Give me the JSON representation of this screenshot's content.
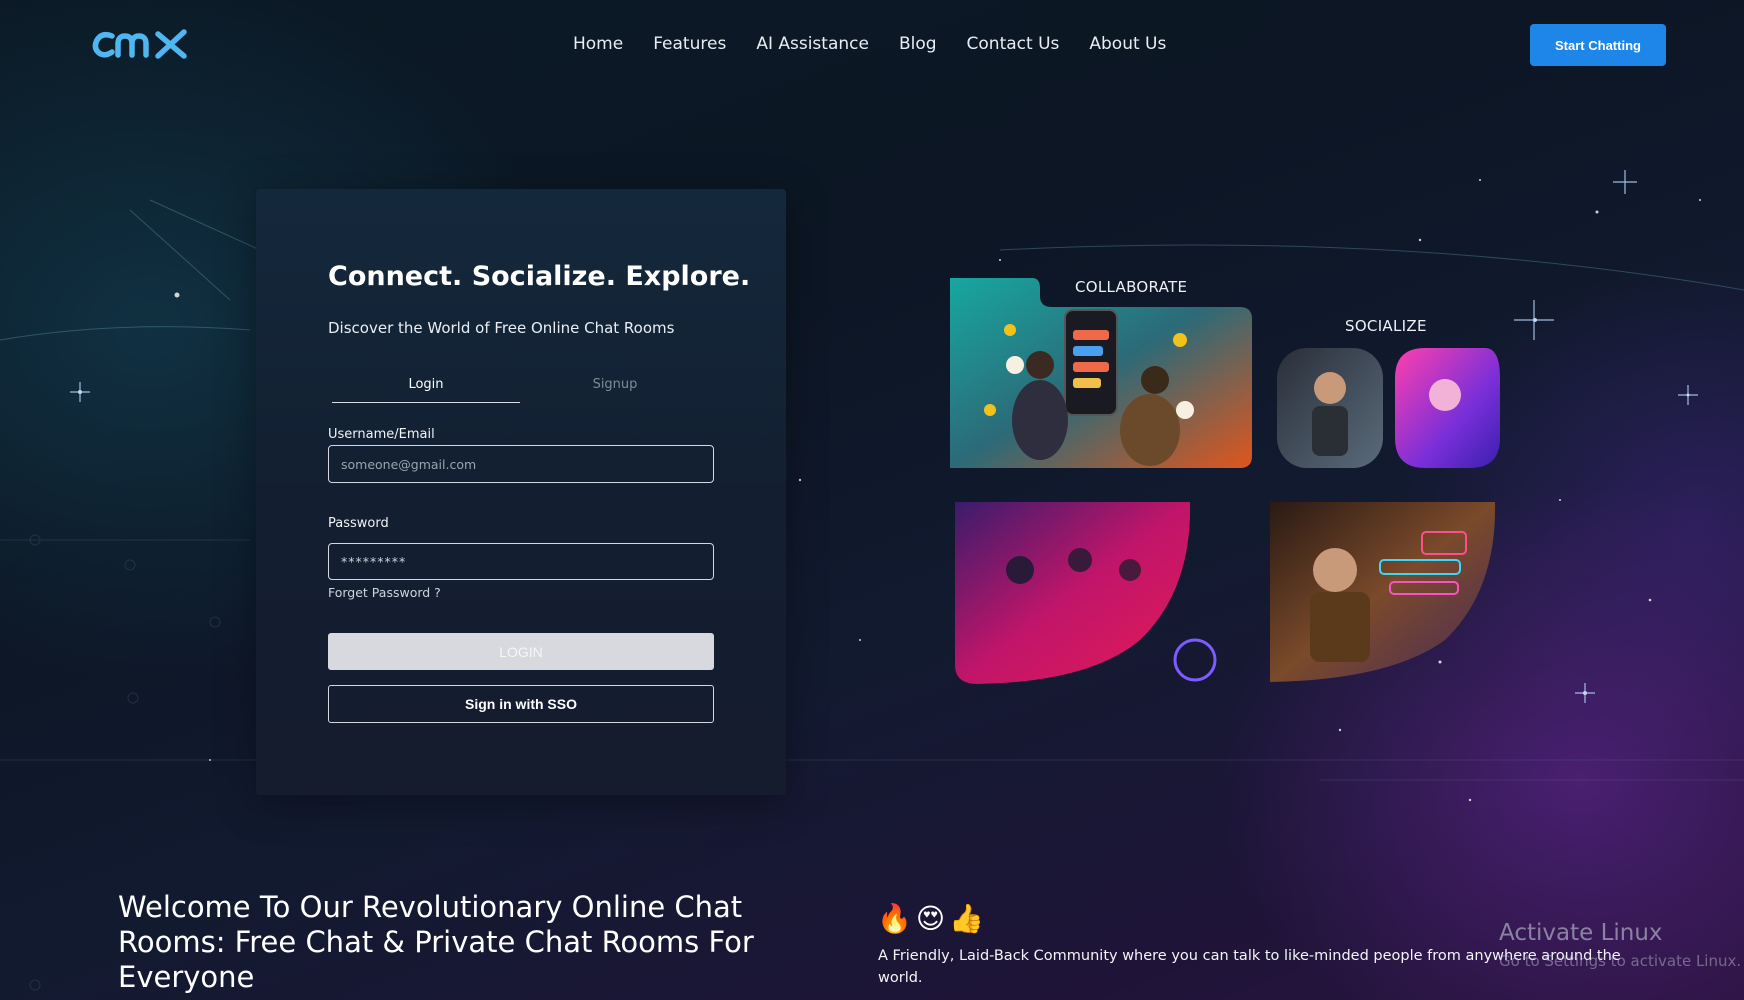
{
  "header": {
    "logo_text": "cmx",
    "nav": [
      "Home",
      "Features",
      "AI Assistance",
      "Blog",
      "Contact Us",
      "About Us"
    ],
    "cta": "Start Chatting"
  },
  "login_card": {
    "title": "Connect. Socialize. Explore.",
    "subtitle": "Discover the World of Free Online Chat Rooms",
    "tabs": {
      "login": "Login",
      "signup": "Signup"
    },
    "username_label": "Username/Email",
    "username_placeholder": "someone@gmail.com",
    "password_label": "Password",
    "password_value": "*********",
    "forgot_password": "Forget Password ?",
    "login_button": "LOGIN",
    "sso_button": "Sign in with SSO"
  },
  "collage": {
    "collaborate_label": "COLLABORATE",
    "socialize_label": "SOCIALIZE"
  },
  "bottom": {
    "welcome": "Welcome To Our Revolutionary Online Chat Rooms: Free Chat & Private Chat Rooms For Everyone",
    "emojis": [
      "🔥",
      "😍",
      "👍"
    ],
    "friendly": "A Friendly, Laid-Back Community where you can talk to like-minded people from anywhere around the world."
  },
  "os_overlay": {
    "title": "Activate Linux",
    "subtitle": "Go to Settings to activate Linux."
  },
  "colors": {
    "accent": "#1e86e8",
    "logo": "#4fb6f0",
    "login_button_bg": "#d7d9de"
  }
}
